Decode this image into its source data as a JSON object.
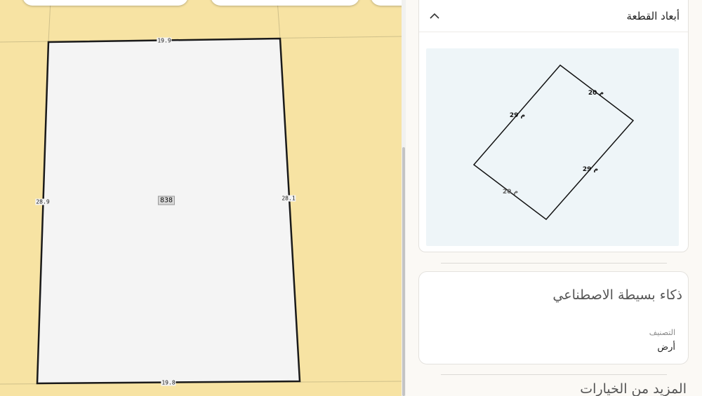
{
  "map": {
    "parcel_area": "838",
    "edge_labels": {
      "top": "19.9",
      "bottom": "19.8",
      "left": "28.9",
      "right": "28.1"
    }
  },
  "panel": {
    "dimensions_section": {
      "title": "أبعاد القطعة",
      "collapse_icon": "chevron-up-icon",
      "shape_labels": [
        "م 20",
        "م 29",
        "م 29",
        "م 20"
      ]
    },
    "ai_section": {
      "title": "ذكاء بسيطة الاصطناعي",
      "classification_label": "التصنيف",
      "classification_value": "أرض"
    },
    "more_options_title": "المزيد من الخيارات"
  },
  "colors": {
    "map_background": "#f7e3a3",
    "parcel_fill": "#f4f4f4",
    "shape_background": "#eef5f8",
    "panel_background": "#fbf9f5"
  }
}
